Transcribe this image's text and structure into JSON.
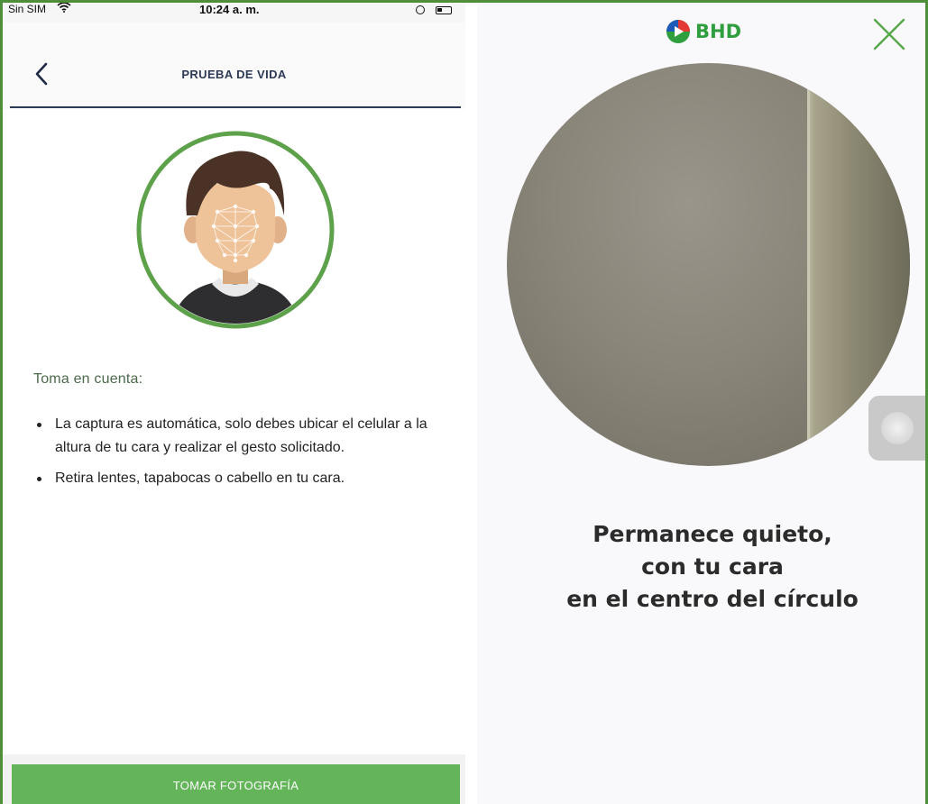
{
  "left_screen": {
    "status_bar": {
      "carrier": "Sin SIM",
      "time": "10:24 a. m."
    },
    "nav": {
      "title": "PRUEBA DE VIDA",
      "back_icon": "chevron-left-icon"
    },
    "avatar_icon": "face-recognition-avatar-icon",
    "subtitle": "Toma en cuenta:",
    "tips": [
      "La captura es automática, solo debes ubicar el celular a la altura de tu cara y realizar el gesto solicitado.",
      "Retira lentes, tapabocas o cabello en tu cara."
    ],
    "button_label": "TOMAR FOTOGRAFÍA"
  },
  "right_screen": {
    "brand": "BHD",
    "close_icon": "close-icon",
    "instruction_lines": [
      "Permanece quieto,",
      "con tu cara",
      "en el centro del círculo"
    ]
  },
  "colors": {
    "accent_green": "#64b45a",
    "frame_green": "#4f8f3a",
    "brand_green": "#2f9e3e",
    "nav_navy": "#2d3a55"
  }
}
